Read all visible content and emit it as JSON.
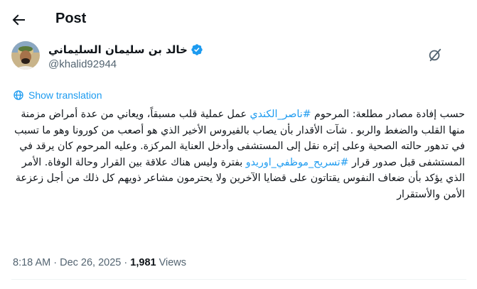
{
  "header": {
    "title": "Post"
  },
  "author": {
    "display_name": "خالد بن سليمان السليماني",
    "handle": "@khalid92944",
    "verified": true
  },
  "translate_label": "Show translation",
  "tweet": {
    "segments": [
      {
        "text": "حسب إفادة مصادر مطلعة: المرحوم ",
        "hashtag": false
      },
      {
        "text": "#ناصر_الكندي",
        "hashtag": true
      },
      {
        "text": " عمل عملية قلب مسبقاً، ويعاني من عدة أمراض مزمنة منها القلب والضغط والربو . شآت الأقدار بأن يصاب بالفيروس الأخير الذي هو أصعب من كورونا وهو ما تسبب في تدهور حالته الصحية وعلى إثره نقل إلى المستشفى وأدخل العناية المركزة. وعليه المرحوم كان يرقد في المستشفى قبل صدور قرار ",
        "hashtag": false
      },
      {
        "text": "#تسريح_موظفي_اوريدو",
        "hashtag": true
      },
      {
        "text": " بفترة وليس هناك علاقة بين القرار وحالة الوفاة. الأمر الذي يؤكد بأن ضعاف النفوس يقتاتون على قضايا الآخرين ولا يحترمون مشاعر ذويهم كل ذلك من أجل زعزعة الأمن والأستقرار",
        "hashtag": false
      }
    ]
  },
  "meta": {
    "time": "8:18 AM",
    "separator": "·",
    "date": "Dec 26, 2025",
    "views_count": "1,981",
    "views_label": "Views"
  },
  "icons": {
    "back": "arrow-left-icon",
    "verified": "verified-badge-icon",
    "grok": "grok-icon",
    "translate": "translate-globe-icon"
  },
  "colors": {
    "accent": "#1d9bf0",
    "text": "#0f1419",
    "secondary": "#536471"
  }
}
